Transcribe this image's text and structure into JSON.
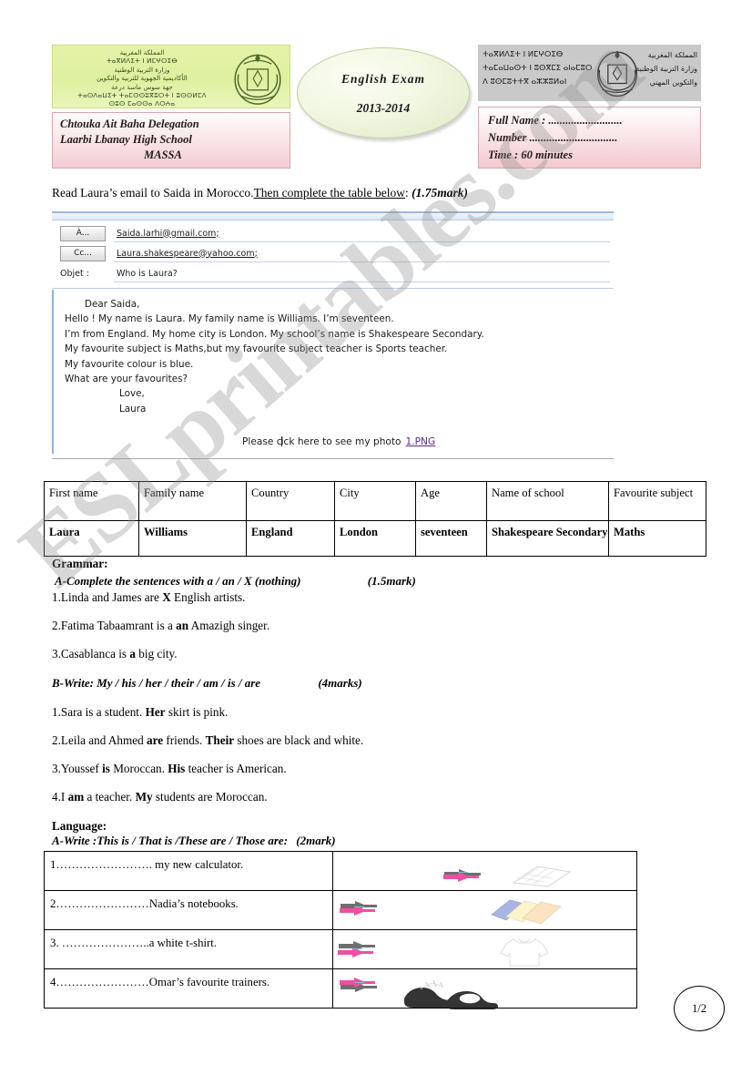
{
  "header": {
    "ministry_left": {
      "lines": [
        "المملكة المغربية",
        "ⵜⴰⴳⵍⴷⵉⵜ ⵏ ⵍⵎⵖⵔⵉⴱ",
        "وزارة التربية الوطنية",
        "الأكاديمية الجهوية للتربية والتكوين",
        "جهة سوس ماسة درعة",
        "ⵜⴰⵙⴷⴰⵡⵉⵜ ⵜⴰⵎⵙⵙⵓⴳⵓⵔⵜ ⵏ ⵓⵙⵙⵍⵎⴷ",
        "ⵙⵓⵙ ⵎⴰⵙⵙⴰ ⴷⵔⵄⴰ"
      ]
    },
    "ministry_right": {
      "arabic_lines": [
        "المملكة المغربية",
        "وزارة التربية الوطنية",
        "والتكوين المهني"
      ],
      "tifinagh_lines": [
        "ⵜⴰⴳⵍⴷⵉⵜ ⵏ ⵍⵎⵖⵔⵉⴱ",
        "ⵜⴰⵎⴰⵡⴰⵙⵜ ⵏ ⵓⵙⴳⵎⵉ ⴰⵏⴰⵎⵓⵔ",
        "ⴷ ⵓⵙⵎⵓⵜⵜⴳ ⴰⵣⵣⵓⵍⴰⵏ"
      ]
    },
    "school_box": {
      "line1": "Chtouka Ait Baha Delegation",
      "line2": "Laarbi Lbanay High School",
      "line3": "MASSA"
    },
    "info_box": {
      "full_name": "Full Name : ..........................",
      "number": "Number ...............................",
      "time": "Time : 60 minutes"
    },
    "exam_oval": {
      "title": "English   Exam",
      "year": "2013-2014"
    }
  },
  "watermark": {
    "text": "ESLprintables.com"
  },
  "instruction": {
    "part1": "Read Laura’s email to Saida in Morocco.",
    "part2_underlined": "Then complete the table below",
    "colon": ":",
    "mark": "(1.75mark)"
  },
  "email": {
    "to_button": "À...",
    "to_value": "Saida.larhi@gmail.com;",
    "cc_button": "Cc...",
    "cc_value": "Laura.shakespeare@yahoo.com;",
    "subject_label": "Objet :",
    "subject_value": "Who is Laura?",
    "body": {
      "greeting": "Dear Saida,",
      "line1": "Hello ! My name is Laura. My family name is Williams. I’m seventeen.",
      "line2": "I’m from England. My home city is London. My school’s name is Shakespeare Secondary.",
      "line3": "My favourite subject is Maths,but my favourite subject teacher is Sports teacher.",
      "line4": "My favourite colour is blue.",
      "line5": "What are your favourites?",
      "closing": "Love,",
      "signature": "Laura"
    },
    "photo_line": {
      "text_before": "Please c",
      "text_after": "ick here to see my photo",
      "link": "1.PNG"
    }
  },
  "answer_table": {
    "headers": [
      "First name",
      "Family name",
      "Country",
      "City",
      "Age",
      "Name of school",
      "Favourite subject"
    ],
    "answers": [
      "Laura",
      "Williams",
      "England",
      "London",
      "seventeen",
      "Shakespeare Secondary",
      "Maths"
    ]
  },
  "grammar": {
    "title": "Grammar:",
    "part_a": {
      "instruction": "A-Complete the sentences  with  a  / an / X  (nothing)",
      "mark": "(1.5mark)",
      "items": [
        {
          "num": "1.",
          "pre": "Linda and James are  ",
          "answer": "X",
          "post": "  English artists."
        },
        {
          "num": "2.",
          "pre": "Fatima Tabaamrant is a ",
          "answer": "an",
          "post": " Amazigh singer."
        },
        {
          "num": "3.",
          "pre": "Casablanca is  ",
          "answer": "a",
          "post": " big city."
        }
      ]
    },
    "part_b": {
      "instruction": "B-Write: My  / his / her /  their / am / is / are",
      "mark": "(4marks)",
      "items": [
        {
          "num": "1.",
          "segments": [
            {
              "t": "Sara is a student. ",
              "b": false
            },
            {
              "t": "Her",
              "b": true
            },
            {
              "t": " skirt is pink.",
              "b": false
            }
          ]
        },
        {
          "num": "2.",
          "segments": [
            {
              "t": "Leila and Ahmed  ",
              "b": false
            },
            {
              "t": "are",
              "b": true
            },
            {
              "t": " friends. ",
              "b": false
            },
            {
              "t": "Their",
              "b": true
            },
            {
              "t": " shoes are black and white.",
              "b": false
            }
          ]
        },
        {
          "num": "3.",
          "segments": [
            {
              "t": "Youssef ",
              "b": false
            },
            {
              "t": "is",
              "b": true
            },
            {
              "t": " Moroccan.  ",
              "b": false
            },
            {
              "t": "His",
              "b": true
            },
            {
              "t": " teacher is American.",
              "b": false
            }
          ]
        },
        {
          "num": "4.",
          "segments": [
            {
              "t": "I ",
              "b": false
            },
            {
              "t": "am",
              "b": true
            },
            {
              "t": " a teacher. ",
              "b": false
            },
            {
              "t": "My",
              "b": true
            },
            {
              "t": " students are Moroccan.",
              "b": false
            }
          ]
        }
      ]
    }
  },
  "language": {
    "title": "Language:",
    "instruction": "A-Write :This is / That is /These are / Those are:",
    "mark": "(2mark)",
    "rows": [
      {
        "text": "1……………………. my new calculator.",
        "icon": "pointing-hand-icon",
        "picture": "calculator-image"
      },
      {
        "text": "2……………………Nadia’s notebooks.",
        "icon": "pointing-hand-icon",
        "picture": "notebooks-image"
      },
      {
        "text": "3. …………………..a white t-shirt.",
        "icon": "pointing-hand-icon",
        "picture": "tshirt-image"
      },
      {
        "text": "4……………………Omar’s favourite trainers.",
        "icon": "pointing-hand-icon",
        "picture": "trainers-image"
      }
    ]
  },
  "page_number": "1/2",
  "colors": {
    "banner_green": "#dff0a0",
    "banner_gray": "#c9c9c9",
    "box_pink": "#f3cdd3",
    "oval_green": "#eef4dd",
    "mail_blue": "#9cb8d6",
    "link_purple": "#5b2a8a",
    "hand_pink": "#ef4fa0",
    "hand_gray": "#6e6e6e",
    "watermark_gray": "#8c8c8c"
  }
}
